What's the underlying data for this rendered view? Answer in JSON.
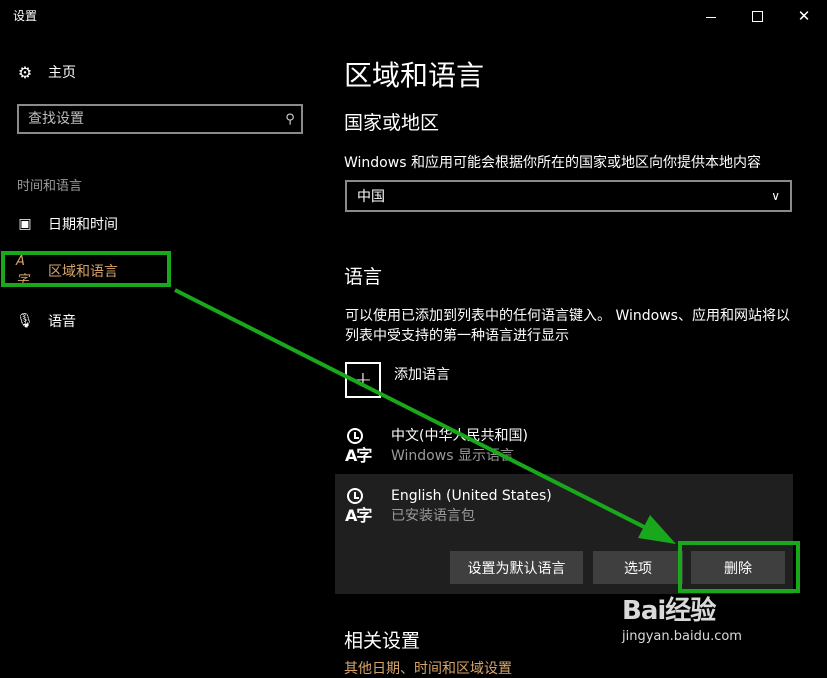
{
  "window": {
    "title": "设置",
    "minimize_icon": "minimize-icon",
    "maximize_icon": "maximize-icon",
    "close_icon": "close-icon"
  },
  "sidebar": {
    "home_label": "主页",
    "search": {
      "placeholder": "查找设置"
    },
    "group_label": "时间和语言",
    "items": [
      {
        "label": "日期和时间",
        "icon": "calendar-clock-icon"
      },
      {
        "label": "区域和语言",
        "icon": "region-language-icon",
        "selected": true
      },
      {
        "label": "语音",
        "icon": "microphone-icon"
      }
    ]
  },
  "main": {
    "page_title": "区域和语言",
    "country_heading": "国家或地区",
    "country_desc": "Windows 和应用可能会根据你所在的国家或地区向你提供本地内容",
    "country_value": "中国",
    "language_heading": "语言",
    "language_desc": "可以使用已添加到列表中的任何语言键入。 Windows、应用和网站将以列表中受支持的第一种语言进行显示",
    "add_language_label": "添加语言",
    "languages": [
      {
        "name": "中文(中华人民共和国)",
        "sub": "Windows 显示语言",
        "glyph": "A字"
      },
      {
        "name": "English (United States)",
        "sub": "已安装语言包",
        "glyph": "A字"
      }
    ],
    "buttons": {
      "set_default": "设置为默认语言",
      "options": "选项",
      "delete": "删除"
    },
    "related_heading": "相关设置",
    "related_link": "其他日期、时间和区域设置"
  },
  "annotation": {
    "color": "#19a71c"
  },
  "watermark": {
    "logo": "Bai经验",
    "url": "jingyan.baidu.com"
  },
  "colors": {
    "accent": "#d7a56a",
    "panel": "#1f1f1f",
    "button": "#3f3f3f"
  }
}
